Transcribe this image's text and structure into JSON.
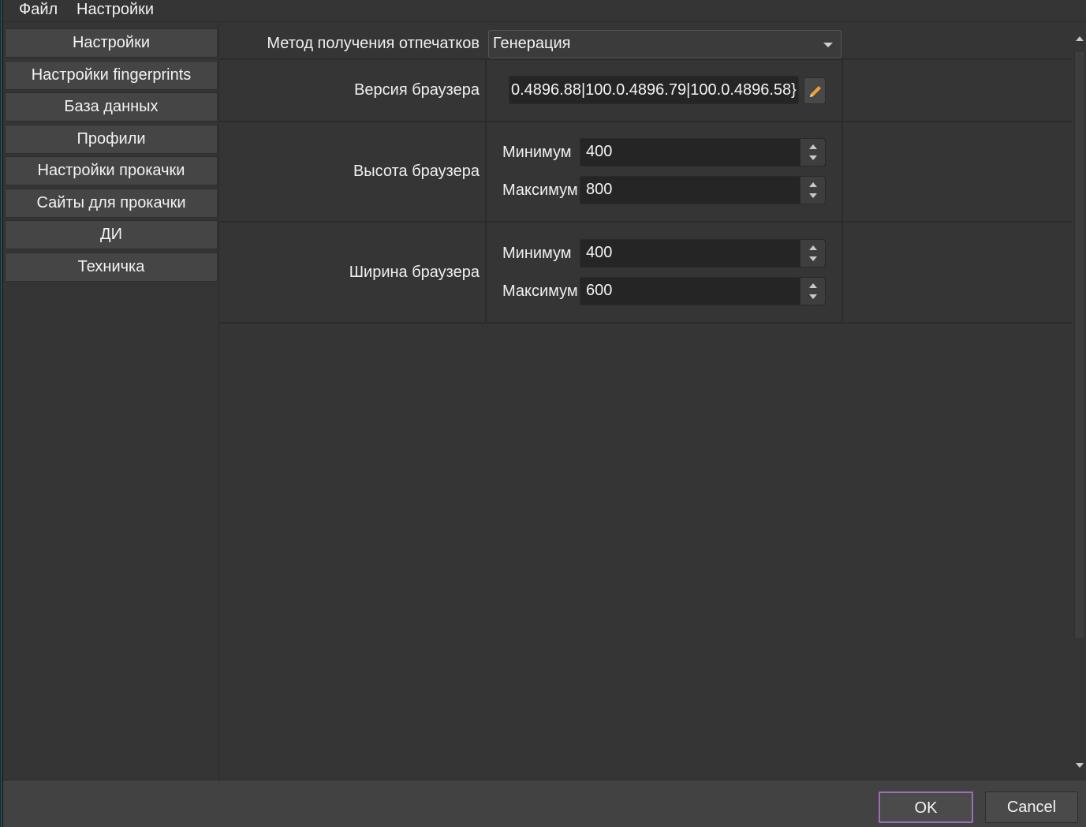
{
  "menubar": {
    "items": [
      "Файл",
      "Настройки"
    ]
  },
  "sidebar": {
    "items": [
      {
        "label": "Настройки"
      },
      {
        "label": "Настройки fingerprints"
      },
      {
        "label": "База данных"
      },
      {
        "label": "Профили"
      },
      {
        "label": "Настройки прокачки"
      },
      {
        "label": "Сайты для прокачки"
      },
      {
        "label": "ДИ"
      },
      {
        "label": "Техничка"
      }
    ]
  },
  "form": {
    "fingerprint_method": {
      "label": "Метод получения отпечатков",
      "value": "Генерация"
    },
    "browser_version": {
      "label": "Версия браузера",
      "value": "0.4896.88|100.0.4896.79|100.0.4896.58}"
    },
    "browser_height": {
      "label": "Высота браузера",
      "min_label": "Минимум",
      "min_value": "400",
      "max_label": "Максимум",
      "max_value": "800"
    },
    "browser_width": {
      "label": "Ширина браузера",
      "min_label": "Минимум",
      "min_value": "400",
      "max_label": "Максимум",
      "max_value": "600"
    }
  },
  "footer": {
    "ok_label": "OK",
    "cancel_label": "Cancel"
  },
  "colors": {
    "background": "#353535",
    "field": "#252525",
    "button": "#454545",
    "ok_border": "#9a6fb8",
    "edit_icon": "#f0a030"
  }
}
